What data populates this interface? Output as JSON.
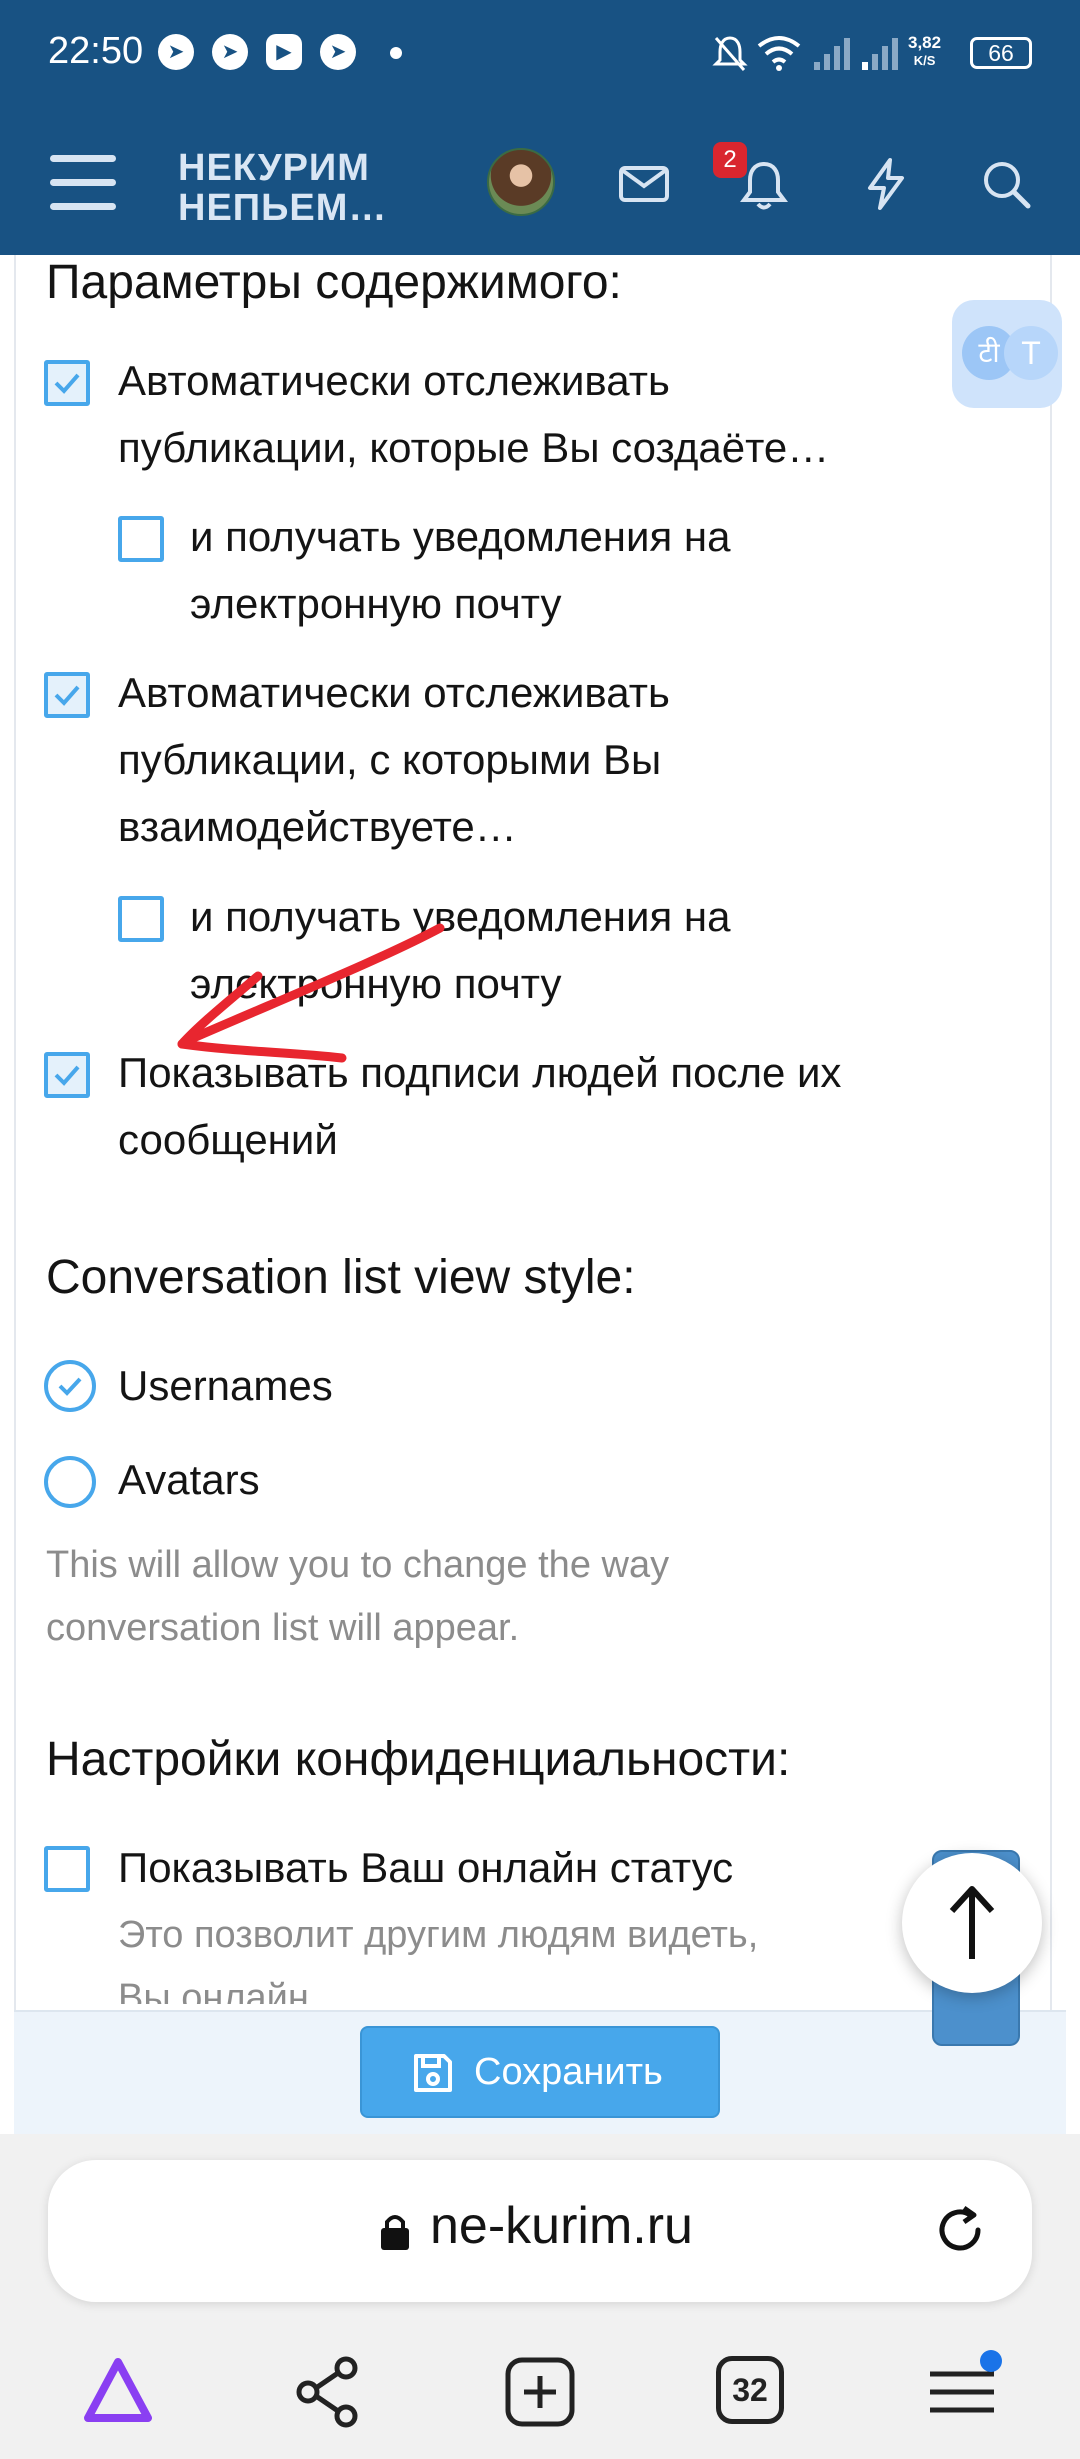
{
  "status_bar": {
    "time": "22:50",
    "speed_value": "3,82",
    "speed_unit": "K/S",
    "battery": "66"
  },
  "header": {
    "logo_line1": "НЕКУРИМ",
    "logo_line2": "НЕПЬЕМ…",
    "notification_count": "2"
  },
  "content_options": {
    "title": "Параметры содержимого:",
    "item1_line1": "Автоматически отслеживать",
    "item1_line2": "публикации, которые Вы создаёте…",
    "item1_checked": true,
    "item1_sub_line1": "и получать уведомления на",
    "item1_sub_line2": "электронную почту",
    "item1_sub_checked": false,
    "item2_line1": "Автоматически отслеживать",
    "item2_line2": "публикации, с которыми Вы",
    "item2_line3": "взаимодействуете…",
    "item2_checked": true,
    "item2_sub_line1": "и получать уведомления на",
    "item2_sub_line2": "электронную почту",
    "item2_sub_checked": false,
    "item3_line1": "Показывать подписи людей после их",
    "item3_line2": "сообщений",
    "item3_checked": true
  },
  "conversation_style": {
    "title": "Conversation list view style:",
    "option1": "Usernames",
    "option2": "Avatars",
    "selected": "Usernames",
    "hint_line1": "This will allow you to change the way",
    "hint_line2": "conversation list will appear."
  },
  "privacy": {
    "title": "Настройки конфиденциальности:",
    "item1": "Показывать Ваш онлайн статус",
    "item1_checked": false,
    "item1_hint_line1": "Это позволит другим людям видеть,",
    "item1_hint_line2": "Вы онлайн."
  },
  "footer": {
    "save_label": "Сохранить"
  },
  "browser": {
    "url": "ne-kurim.ru",
    "tabs_count": "32"
  },
  "translate_widget": {
    "glyph1": "टी",
    "glyph2": "T"
  },
  "colors": {
    "header": "#185283",
    "accent": "#47a7eb",
    "annotation": "#e8262f"
  }
}
